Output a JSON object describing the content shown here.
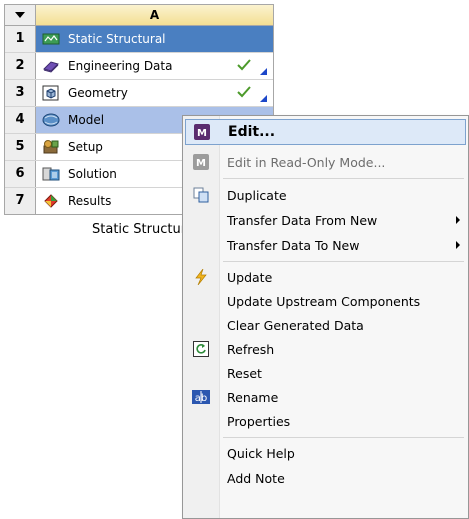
{
  "system": {
    "column_header": "A",
    "caption": "Static Structural",
    "rows": [
      {
        "num": "1",
        "label": "Static Structural",
        "icon": "static-structural-icon"
      },
      {
        "num": "2",
        "label": "Engineering Data",
        "icon": "engineering-data-icon"
      },
      {
        "num": "3",
        "label": "Geometry",
        "icon": "geometry-icon"
      },
      {
        "num": "4",
        "label": "Model",
        "icon": "model-icon"
      },
      {
        "num": "5",
        "label": "Setup",
        "icon": "setup-icon"
      },
      {
        "num": "6",
        "label": "Solution",
        "icon": "solution-icon"
      },
      {
        "num": "7",
        "label": "Results",
        "icon": "results-icon"
      }
    ]
  },
  "menu": {
    "items": [
      {
        "label": "Edit...",
        "icon": "mechanical-icon"
      },
      {
        "label": "Edit in Read-Only Mode...",
        "icon": "mechanical-gray-icon"
      },
      {
        "label": "Duplicate",
        "icon": "duplicate-icon"
      },
      {
        "label": "Transfer Data From New"
      },
      {
        "label": "Transfer Data To New"
      },
      {
        "label": "Update",
        "icon": "update-bolt-icon"
      },
      {
        "label": "Update Upstream Components"
      },
      {
        "label": "Clear Generated Data"
      },
      {
        "label": "Refresh",
        "icon": "refresh-icon"
      },
      {
        "label": "Reset"
      },
      {
        "label": "Rename",
        "icon": "rename-icon"
      },
      {
        "label": "Properties"
      },
      {
        "label": "Quick Help"
      },
      {
        "label": "Add Note"
      }
    ]
  }
}
